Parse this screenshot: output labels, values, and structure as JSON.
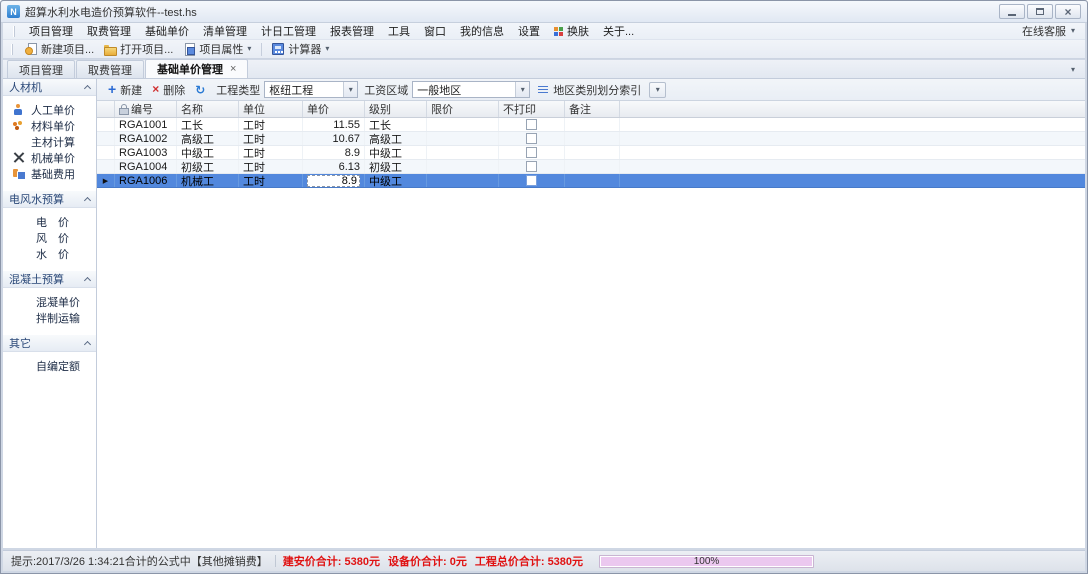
{
  "window": {
    "title": "超算水利水电造价预算软件--test.hs"
  },
  "menu": {
    "items": [
      {
        "label": "项目管理"
      },
      {
        "label": "取费管理"
      },
      {
        "label": "基础单价"
      },
      {
        "label": "清单管理"
      },
      {
        "label": "计日工管理"
      },
      {
        "label": "报表管理"
      },
      {
        "label": "工具"
      },
      {
        "label": "窗口"
      },
      {
        "label": "我的信息"
      },
      {
        "label": "设置"
      },
      {
        "label": "换肤",
        "icon": "skin-grid"
      },
      {
        "label": "关于..."
      }
    ],
    "right_label": "在线客服"
  },
  "toolbar": {
    "new_project": "新建项目...",
    "open_project": "打开项目...",
    "project_properties": "项目属性",
    "calculator": "计算器"
  },
  "tabs": [
    {
      "label": "项目管理",
      "active": false,
      "closable": false
    },
    {
      "label": "取费管理",
      "active": false,
      "closable": false
    },
    {
      "label": "基础单价管理",
      "active": true,
      "closable": true
    }
  ],
  "sidebar": {
    "groups": [
      {
        "title": "人材机",
        "items": [
          {
            "label": "人工单价",
            "icon": "person"
          },
          {
            "label": "材料单价",
            "icon": "material"
          },
          {
            "label": "主材计算"
          },
          {
            "label": "机械单价",
            "icon": "tools"
          },
          {
            "label": "基础费用",
            "icon": "fees"
          }
        ]
      },
      {
        "title": "电风水预算",
        "items": [
          {
            "label": "电　价"
          },
          {
            "label": "风　价"
          },
          {
            "label": "水　价"
          }
        ]
      },
      {
        "title": "混凝土预算",
        "items": [
          {
            "label": "混凝单价"
          },
          {
            "label": "拌制运输"
          }
        ]
      },
      {
        "title": "其它",
        "items": [
          {
            "label": "自编定额"
          }
        ]
      }
    ]
  },
  "grid_toolbar": {
    "add_label": "新建",
    "delete_label": "删除",
    "type_label": "工程类型",
    "type_value": "枢纽工程",
    "region_label": "工资区域",
    "region_value": "一般地区",
    "index_label": "地区类别划分索引"
  },
  "table": {
    "columns": [
      "编号",
      "名称",
      "单位",
      "单价",
      "级别",
      "限价",
      "不打印",
      "备注"
    ],
    "rows": [
      {
        "code": "RGA1001",
        "name": "工长",
        "unit": "工时",
        "price": "11.55",
        "level": "工长",
        "limit": "",
        "noprint": false,
        "note": "",
        "selected": false
      },
      {
        "code": "RGA1002",
        "name": "高级工",
        "unit": "工时",
        "price": "10.67",
        "level": "高级工",
        "limit": "",
        "noprint": false,
        "note": "",
        "selected": false
      },
      {
        "code": "RGA1003",
        "name": "中级工",
        "unit": "工时",
        "price": "8.9",
        "level": "中级工",
        "limit": "",
        "noprint": false,
        "note": "",
        "selected": false
      },
      {
        "code": "RGA1004",
        "name": "初级工",
        "unit": "工时",
        "price": "6.13",
        "level": "初级工",
        "limit": "",
        "noprint": false,
        "note": "",
        "selected": false
      },
      {
        "code": "RGA1006",
        "name": "机械工",
        "unit": "工时",
        "price": "8.9",
        "level": "中级工",
        "limit": "",
        "noprint": false,
        "note": "",
        "selected": true,
        "price_editing": true
      }
    ]
  },
  "statusbar": {
    "hint": "提示:2017/3/26 1:34:21合计的公式中【其他摊销费】",
    "totals": [
      {
        "label": "建安价合计",
        "value": "5380元"
      },
      {
        "label": "设备价合计",
        "value": "0元"
      },
      {
        "label": "工程总价合计",
        "value": "5380元"
      }
    ],
    "progress_label": "100%"
  },
  "colors": {
    "selection_blue": "#5288dd",
    "status_red": "#e01212",
    "progress_pink": "#ebc8ef"
  }
}
